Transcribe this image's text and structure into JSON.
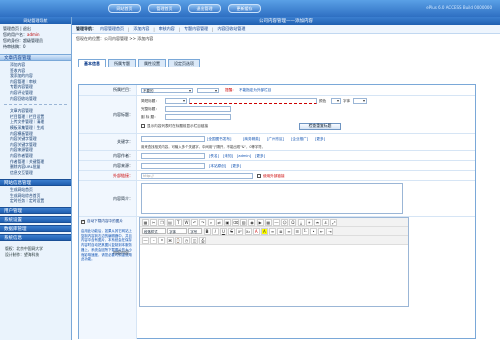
{
  "topbar": {
    "tabs": [
      "网站首页",
      "管理首页",
      "退出管理",
      "更新缓存"
    ],
    "version": "ePlus 6.0 ACCESS Build 0000000"
  },
  "sidebar": {
    "title": "网站管理导航",
    "user_line1": "管理首页 | 退出",
    "user_line2_label": "您的用户名：",
    "user_line2_value": "admin",
    "user_line3": "您的身份：超级管理员",
    "user_line4": "待审核稿：0",
    "content_head": "文章内容管理",
    "content_items": [
      "添加内容",
      "签收内容",
      "我添加的内容",
      "内容管理｜审核",
      "专题内容管理",
      "内容评论管理",
      "内容回收站管理"
    ],
    "content_items2": [
      "文章内容管理",
      "栏目管理｜栏目设置",
      "上传文件管理｜清理",
      "模板采集管理｜生成",
      "内容模板管理",
      "内容关键字管理",
      "内容关键字管理",
      "内容来源管理",
      "内容作者管理",
      "作者管理｜关键管理",
      "删除内容URL批量",
      "信息交互管理"
    ],
    "site_head": "网站信息管理",
    "site_items": [
      "生成网站首页",
      "生成网站综合首页",
      "定时任务｜定时设置"
    ],
    "heads": [
      "用户管理",
      "系统设置",
      "数据库管理",
      "系统信息"
    ],
    "foot_line1": "版权：北京中国网大学",
    "foot_line2": "设计制作：望海科技"
  },
  "main": {
    "title": "公司内容管理——添加内容",
    "nav_label": "管理导航：",
    "nav_items": [
      "内容管理首页",
      "添加内容",
      "审核内容",
      "专题内容管理",
      "内容回收站管理"
    ],
    "location": "您现在的位置：公司内容管理 >> 添加内容",
    "tabs": [
      "基本信息",
      "所属专题",
      "属性设置",
      "设定页选项"
    ]
  },
  "form": {
    "category_label": "所属栏目：",
    "category_value": "不要的",
    "category_note": "提醒：",
    "category_note2": "不能指定为外部栏目",
    "title_label": "内容标题：",
    "short_title_label": "简短标题：",
    "full_title_label": "完整标题：",
    "sub_title_label": "副 标 题：",
    "color_label": "颜色",
    "font_label": "字体",
    "dup_check_text": "显示内容列表时在标题前显示栏目链接",
    "dup_button": "检查重复标题",
    "keywords_label": "关键字：",
    "keywords_hint": "用来查找相关内容，可输入多个关键字，中间用\"|\"隔开，不能出现\"&\"，0等字符。",
    "keywords_links": [
      "[全国图书发布]",
      "[商务精英]",
      "[广州东区]",
      "[企业推广]",
      "[更多]"
    ],
    "author_label": "内容作者：",
    "author_links": [
      "[佚名]",
      "[未知]",
      "[admin]",
      "[更多]"
    ],
    "source_label": "内容来源：",
    "source_links": [
      "[本站原创]",
      "[更多]"
    ],
    "link_label": "外部链接：",
    "link_placeholder": "http://",
    "link_check_text": "使用外部链接",
    "summary_label": "内容简介：",
    "content_label": "内容内容：",
    "auto_pick_text": "自动下载内容中的图片",
    "auto_pick_desc": "启用此功能后，如果从其它网站上复制内容到右边的编辑器中，并且内容中含有图片，本系统会在保存内容时自动把其图片复制到本服务器上。系统会因所下载图片的大小而影响速度，请您必要时慎重使用此功能。",
    "editor_font": "字体",
    "editor_size": "字号",
    "editor_style": "段落样式"
  }
}
